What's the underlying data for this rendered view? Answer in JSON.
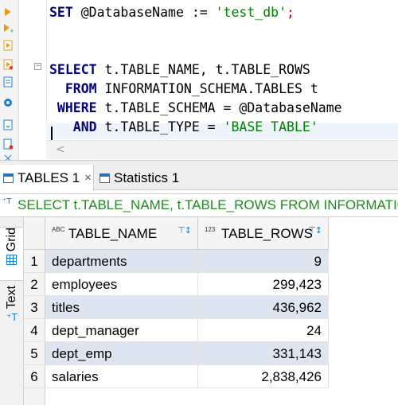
{
  "editor": {
    "lines": [
      {
        "parts": [
          {
            "t": "SET",
            "c": "kw"
          },
          {
            "t": " @DatabaseName := ",
            "c": "id"
          },
          {
            "t": "'test_db'",
            "c": "str"
          },
          {
            "t": ";",
            "c": "semi"
          }
        ]
      },
      {
        "parts": []
      },
      {
        "parts": []
      },
      {
        "parts": [
          {
            "t": "SELECT",
            "c": "kw"
          },
          {
            "t": " t.TABLE_NAME, t.TABLE_ROWS",
            "c": "id"
          }
        ]
      },
      {
        "parts": [
          {
            "t": "  FROM",
            "c": "kw"
          },
          {
            "t": " INFORMATION_SCHEMA.TABLES t",
            "c": "id"
          }
        ]
      },
      {
        "parts": [
          {
            "t": " WHERE",
            "c": "kw"
          },
          {
            "t": " t.TABLE_SCHEMA = @DatabaseName",
            "c": "id"
          }
        ]
      },
      {
        "parts": [
          {
            "t": "   AND",
            "c": "kw"
          },
          {
            "t": " t.TABLE_TYPE = ",
            "c": "id"
          },
          {
            "t": "'BASE TABLE'",
            "c": "str"
          }
        ]
      }
    ],
    "gutter_icons": [
      "run-statement-icon",
      "run-script-icon",
      "execute-file-icon",
      "explain-plan-icon",
      "document-icon",
      "settings-icon",
      "export-icon",
      "file-error-icon",
      "close-editor-icon"
    ]
  },
  "results": {
    "tabs": [
      {
        "label": "TABLES 1",
        "active": true,
        "closable": true
      },
      {
        "label": "Statistics 1",
        "active": false,
        "closable": false
      }
    ],
    "close_glyph": "×",
    "query_text": "SELECT t.TABLE_NAME, t.TABLE_ROWS FROM INFORMATION_SCHEMA.TABLES t WHERE t.TABLE_SCHEMA = @DatabaseName AND t.TABLE_TYPE = 'BASE TABLE'",
    "side_tabs": {
      "grid": "Grid",
      "text": "Text"
    },
    "columns": [
      {
        "type": "ABC",
        "label": "TABLE_NAME"
      },
      {
        "type": "123",
        "label": "TABLE_ROWS"
      }
    ],
    "rows": [
      {
        "num": "1",
        "name": "departments",
        "rows": "9"
      },
      {
        "num": "2",
        "name": "employees",
        "rows": "299,423"
      },
      {
        "num": "3",
        "name": "titles",
        "rows": "436,962"
      },
      {
        "num": "4",
        "name": "dept_manager",
        "rows": "24"
      },
      {
        "num": "5",
        "name": "dept_emp",
        "rows": "331,143"
      },
      {
        "num": "6",
        "name": "salaries",
        "rows": "2,838,426"
      }
    ]
  }
}
